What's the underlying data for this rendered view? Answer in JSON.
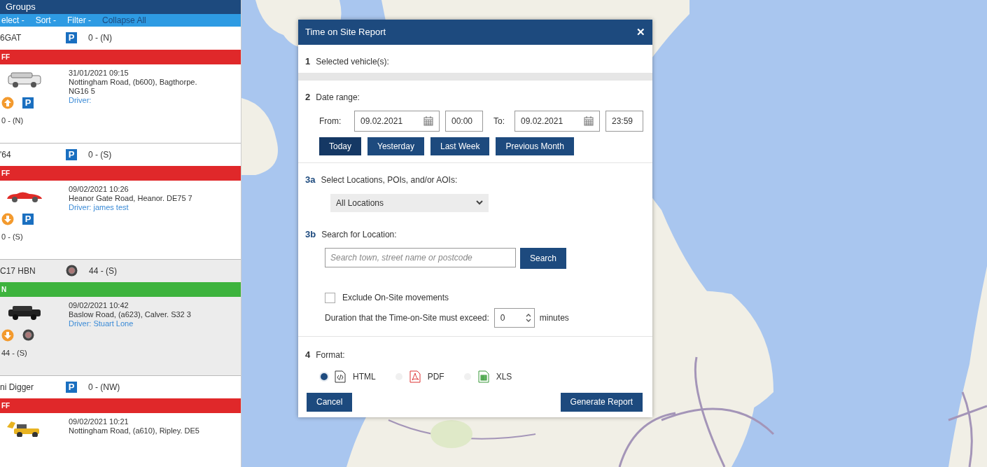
{
  "sidebar": {
    "title": "Groups",
    "toolbar": [
      {
        "label": "elect -",
        "kind": "menu"
      },
      {
        "label": "Sort -",
        "kind": "menu"
      },
      {
        "label": "Filter -",
        "kind": "menu"
      },
      {
        "label": "Collapse All",
        "kind": "action"
      }
    ],
    "vehicles": [
      {
        "plate": "6GAT",
        "summary_icon": {
          "kind": "parking",
          "label": "P"
        },
        "heading": "0 - (N)",
        "state": "FF",
        "color": "#e0282a",
        "selected": false,
        "kind": "suv",
        "date": "31/01/2021 09:15",
        "address": "Nottingham Road, (b600), Bagthorpe. NG16 5",
        "driver": "Driver:",
        "direction_icon": {
          "kind": "up"
        },
        "detail_icon": {
          "kind": "parking",
          "label": "P"
        },
        "detail_heading": "0 - (N)"
      },
      {
        "plate": "'64",
        "summary_icon": {
          "kind": "parking",
          "label": "P"
        },
        "heading": "0 - (S)",
        "state": "FF",
        "color": "#e0282a",
        "selected": false,
        "kind": "sports",
        "date": "09/02/2021 10:26",
        "address": "Heanor Gate Road, Heanor. DE75 7",
        "driver": "Driver: james test",
        "direction_icon": {
          "kind": "down"
        },
        "detail_icon": {
          "kind": "parking",
          "label": "P"
        },
        "detail_heading": "0 - (S)"
      },
      {
        "plate": "C17 HBN",
        "summary_icon": {
          "kind": "wheel"
        },
        "heading": "44 - (S)",
        "state": "N",
        "color": "#3db33d",
        "selected": true,
        "kind": "jeep",
        "date": "09/02/2021 10:42",
        "address": "Baslow Road, (a623), Calver. S32 3",
        "driver": "Driver: Stuart Lone",
        "direction_icon": {
          "kind": "down"
        },
        "detail_icon": {
          "kind": "wheel"
        },
        "detail_heading": "44 - (S)"
      },
      {
        "plate": "ni Digger",
        "summary_icon": {
          "kind": "parking",
          "label": "P"
        },
        "heading": "0 - (NW)",
        "state": "FF",
        "color": "#e0282a",
        "selected": false,
        "kind": "digger",
        "date": "09/02/2021 10:21",
        "address": "Nottingham Road, (a610), Ripley. DE5"
      }
    ]
  },
  "dialog": {
    "title": "Time on Site Report",
    "close": "✕",
    "vehicles_section": {
      "number": "1",
      "label": "Selected vehicle(s):"
    },
    "date_section": {
      "number": "2",
      "label": "Date range:",
      "from_label": "From:",
      "from_date": "09.02.2021",
      "from_time": "00:00",
      "to_label": "To:",
      "to_date": "09.02.2021",
      "to_time": "23:59",
      "presets": [
        {
          "label": "Today",
          "selected": true
        },
        {
          "label": "Yesterday",
          "selected": false
        },
        {
          "label": "Last Week",
          "selected": false
        },
        {
          "label": "Previous Month",
          "selected": false
        }
      ]
    },
    "locations_section": {
      "number": "3a",
      "label": "Select Locations, POIs, and/or AOIs:",
      "value": "All Locations"
    },
    "search_section": {
      "number": "3b",
      "label": "Search for Location:",
      "placeholder": "Search town, street name or postcode",
      "button": "Search",
      "exclude": {
        "label": "Exclude On-Site movements",
        "checked": false
      },
      "duration_label": "Duration that the Time-on-Site must exceed:",
      "duration": "0",
      "unit": "minutes"
    },
    "format_section": {
      "number": "4",
      "label": "Format:",
      "options": [
        {
          "label": "HTML",
          "kind": "html",
          "selected": true
        },
        {
          "label": "PDF",
          "kind": "pdf",
          "selected": false
        },
        {
          "label": "XLS",
          "kind": "xls",
          "selected": false
        }
      ]
    },
    "cancel": "Cancel",
    "submit": "Generate Report"
  }
}
